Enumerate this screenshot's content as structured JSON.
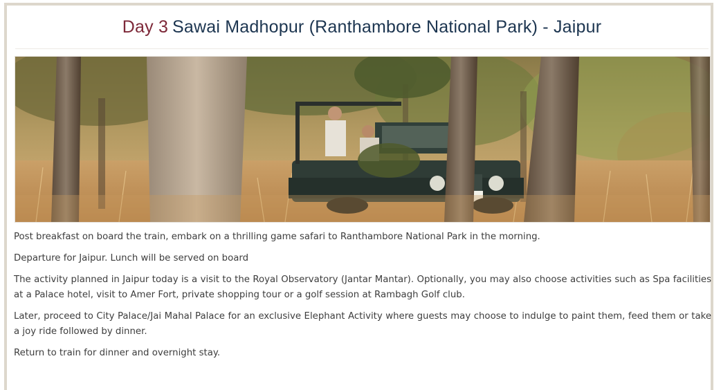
{
  "itinerary": {
    "day_label": "Day 3",
    "route": "Sawai Madhopur (Ranthambore National Park) - Jaipur",
    "photo_subject": "safari-jeep-in-forest",
    "paragraphs": [
      "Post breakfast on board the train, embark on a thrilling game safari to Ranthambore National Park in the morning.",
      "Departure for Jaipur. Lunch will be served on board",
      "The activity planned in Jaipur today is a visit to the Royal Observatory (Jantar Mantar). Optionally, you may also choose activities such as Spa facilities at a Palace hotel, visit to Amer Fort, private shopping tour or a golf session at Rambagh Golf club.",
      "Later, proceed to City Palace/Jai Mahal Palace for an exclusive Elephant Activity where guests may choose to indulge to paint them, feed them or take a joy ride followed by dinner.",
      "Return to train for dinner and overnight stay."
    ]
  },
  "colors": {
    "day_label": "#7d2838",
    "route": "#1c3550",
    "body_text": "#3d3d3d",
    "frame_border": "#ddd7cc"
  }
}
